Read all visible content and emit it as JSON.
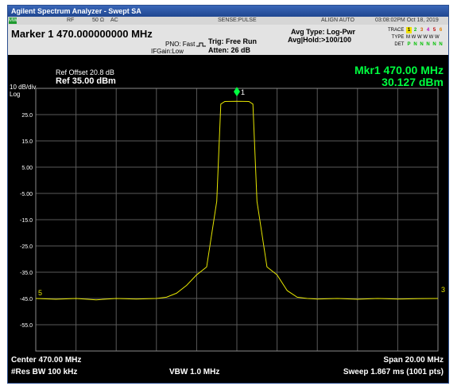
{
  "window": {
    "title": "Agilent Spectrum Analyzer - Swept SA"
  },
  "status_bar": {
    "mode_icon": "MW",
    "rf": "RF",
    "impedance": "50 Ω",
    "coupling": "AC",
    "sense": "SENSE:PULSE",
    "align": "ALIGN AUTO",
    "datetime": "03:08:02PM Oct 18, 2019"
  },
  "info": {
    "marker_readout": "Marker 1 470.000000000 MHz",
    "pno": "PNO: Fast",
    "ifgain": "IFGain:Low",
    "trig": "Trig: Free Run",
    "atten": "Atten: 26 dB",
    "avg_type": "Avg Type: Log-Pwr",
    "avg_hold": "Avg|Hold:>100/100",
    "trace_label": "TRACE",
    "trace_nums": [
      "1",
      "2",
      "3",
      "4",
      "5",
      "6"
    ],
    "type_label": "TYPE",
    "type_vals": "M W W W W W",
    "det_label": "DET",
    "det_vals": [
      "P",
      "N",
      "N",
      "N",
      "N",
      "N"
    ]
  },
  "plot": {
    "ref_offset": "Ref Offset 20.8 dB",
    "ref_level": "Ref 35.00 dBm",
    "scale": "10 dB/div",
    "scale_type": "Log",
    "mkr_label": "Mkr1 470.00 MHz",
    "mkr_value": "30.127 dBm",
    "marker_num": "1",
    "left_marker": "5",
    "right_marker": "3",
    "y_ticks": [
      "25.0",
      "15.0",
      "5.00",
      "-5.00",
      "-15.0",
      "-25.0",
      "-35.0",
      "-45.0",
      "-55.0"
    ],
    "center": "Center 470.00 MHz",
    "span": "Span 20.00 MHz",
    "res_bw": "#Res BW 100 kHz",
    "vbw": "VBW 1.0 MHz",
    "sweep": "Sweep 1.867 ms (1001 pts)",
    "trace_color": "#e6e600",
    "grid_color": "#5a5a5a"
  },
  "chart_data": {
    "type": "line",
    "title": "",
    "xlabel": "Center 470.00 MHz / Span 20.00 MHz",
    "ylabel": "dBm",
    "xlim": [
      460,
      480
    ],
    "ylim": [
      -65,
      35
    ],
    "series": [
      {
        "name": "Trace 1",
        "x": [
          460,
          461,
          462,
          463,
          464,
          465,
          466,
          466.5,
          467,
          467.5,
          468,
          468.5,
          469,
          469.2,
          469.4,
          470,
          470.6,
          470.8,
          471,
          471.5,
          472,
          472.5,
          473,
          473.5,
          474,
          475,
          476,
          477,
          478,
          479,
          480
        ],
        "y": [
          -45,
          -45.3,
          -45,
          -45.5,
          -45,
          -45.2,
          -45,
          -44.5,
          -43,
          -40,
          -36,
          -33,
          -8,
          29,
          30,
          30.1,
          30,
          29,
          -8,
          -33,
          -36,
          -42,
          -44.5,
          -45,
          -45.2,
          -45,
          -45.3,
          -45,
          -45.2,
          -45.1,
          -45
        ]
      }
    ]
  }
}
